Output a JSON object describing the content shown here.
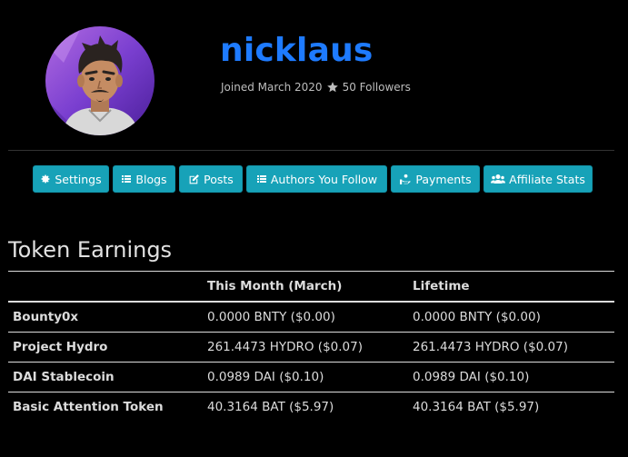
{
  "profile": {
    "username": "nicklaus",
    "joined": "Joined March 2020",
    "followers": "50 Followers",
    "avatar_icon": "user-avatar"
  },
  "nav": [
    {
      "label": "Settings",
      "icon": "gear-icon"
    },
    {
      "label": "Blogs",
      "icon": "list-icon"
    },
    {
      "label": "Posts",
      "icon": "edit-icon"
    },
    {
      "label": "Authors You Follow",
      "icon": "list-icon"
    },
    {
      "label": "Payments",
      "icon": "hand-coin-icon"
    },
    {
      "label": "Affiliate Stats",
      "icon": "users-icon"
    }
  ],
  "earnings": {
    "title": "Token Earnings",
    "headers": [
      "",
      "This Month (March)",
      "Lifetime"
    ],
    "rows": [
      {
        "name": "Bounty0x",
        "month": "0.0000 BNTY ($0.00)",
        "lifetime": "0.0000 BNTY ($0.00)"
      },
      {
        "name": "Project Hydro",
        "month": "261.4473 HYDRO ($0.07)",
        "lifetime": "261.4473 HYDRO ($0.07)"
      },
      {
        "name": "DAI Stablecoin",
        "month": "0.0989 DAI ($0.10)",
        "lifetime": "0.0989 DAI ($0.10)"
      },
      {
        "name": "Basic Attention Token",
        "month": "40.3164 BAT ($5.97)",
        "lifetime": "40.3164 BAT ($5.97)"
      }
    ]
  },
  "colors": {
    "background": "#000000",
    "username": "#1e7bff",
    "button": "#17a2b8"
  }
}
